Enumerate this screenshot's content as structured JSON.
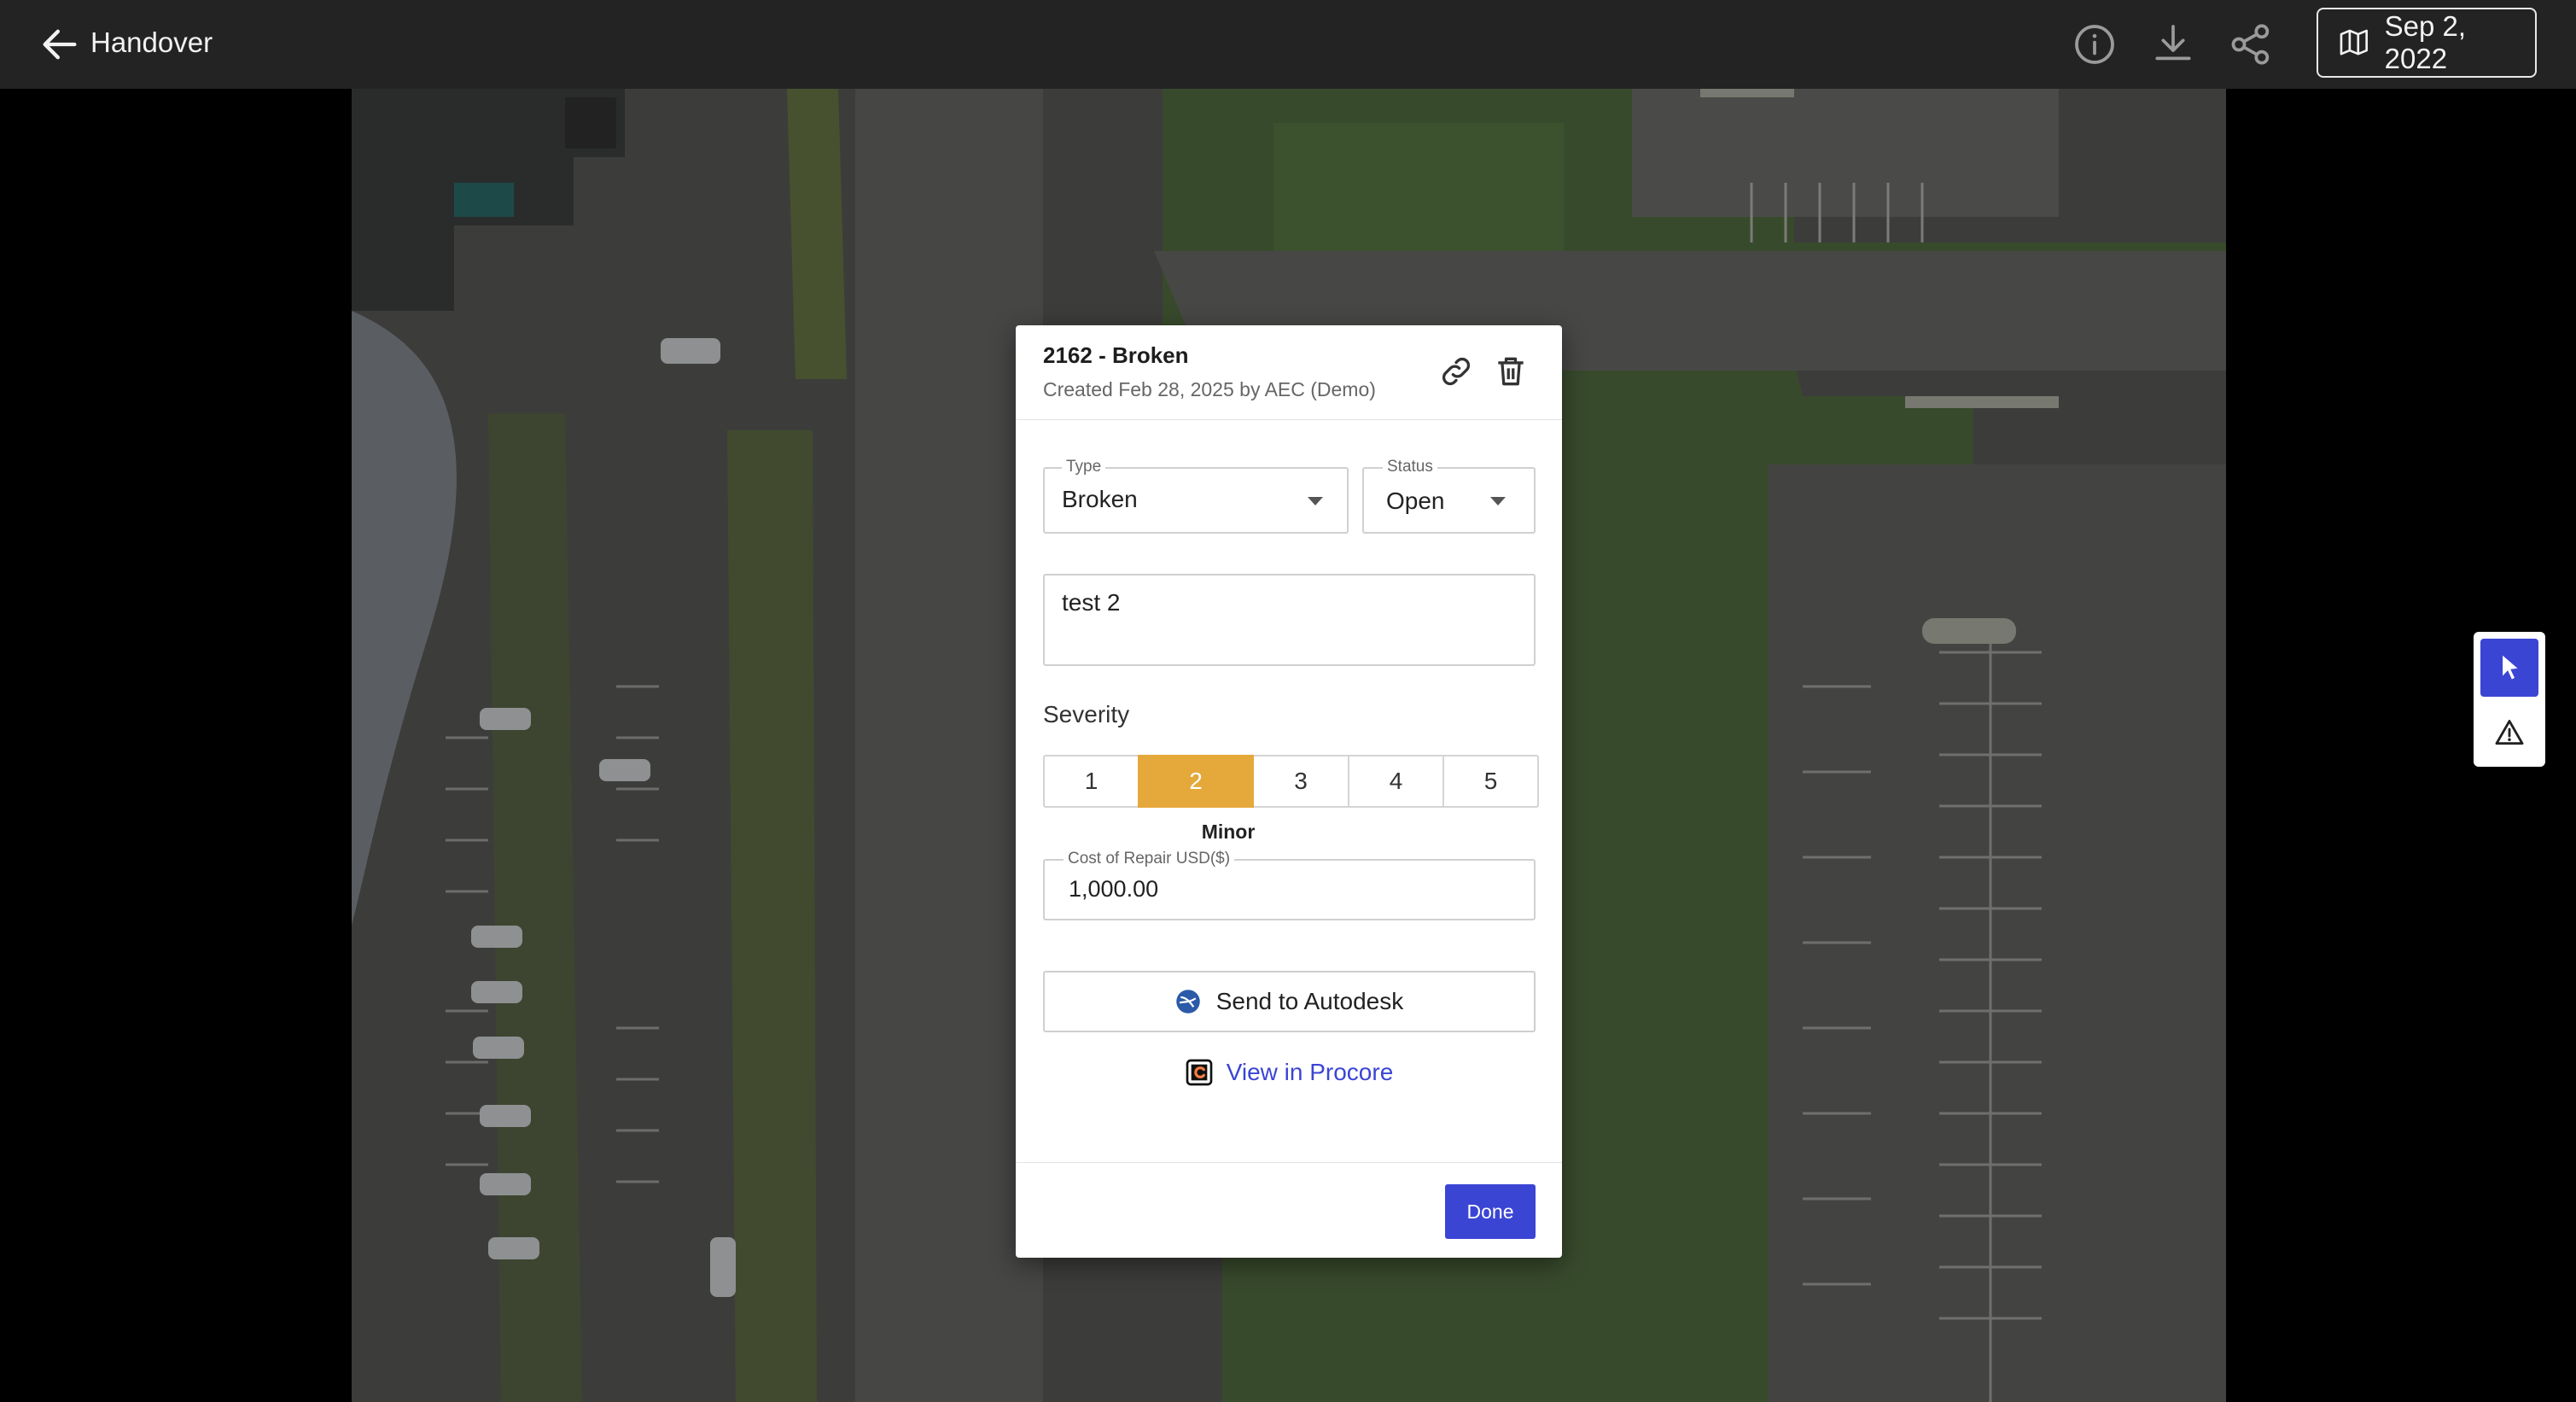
{
  "header": {
    "back_icon": "arrow-left-icon",
    "title": "Handover",
    "icons": [
      "info-icon",
      "download-icon",
      "share-icon"
    ],
    "date_icon": "map-icon",
    "date": "Sep 2, 2022"
  },
  "tools": {
    "items": [
      {
        "icon": "cursor-icon",
        "active": true
      },
      {
        "icon": "warning-triangle-icon",
        "active": false
      }
    ],
    "active_color": "#3b45d4"
  },
  "issue": {
    "title": "2162 - Broken",
    "subtitle": "Created Feb 28, 2025 by AEC (Demo)",
    "header_icons": [
      "link-icon",
      "trash-icon"
    ],
    "type": {
      "label": "Type",
      "value": "Broken"
    },
    "status": {
      "label": "Status",
      "value": "Open"
    },
    "description": "test 2",
    "severity": {
      "label": "Severity",
      "options": [
        "1",
        "2",
        "3",
        "4",
        "5"
      ],
      "selected": "2",
      "caption": "Minor",
      "selected_color": "#e5a83a"
    },
    "cost": {
      "label": "Cost of Repair USD($)",
      "value": "1,000.00"
    },
    "autodesk_button": "Send to Autodesk",
    "procore_link": "View in Procore",
    "done_button": "Done"
  },
  "colors": {
    "topbar": "#232323",
    "accent": "#3b45d4"
  }
}
